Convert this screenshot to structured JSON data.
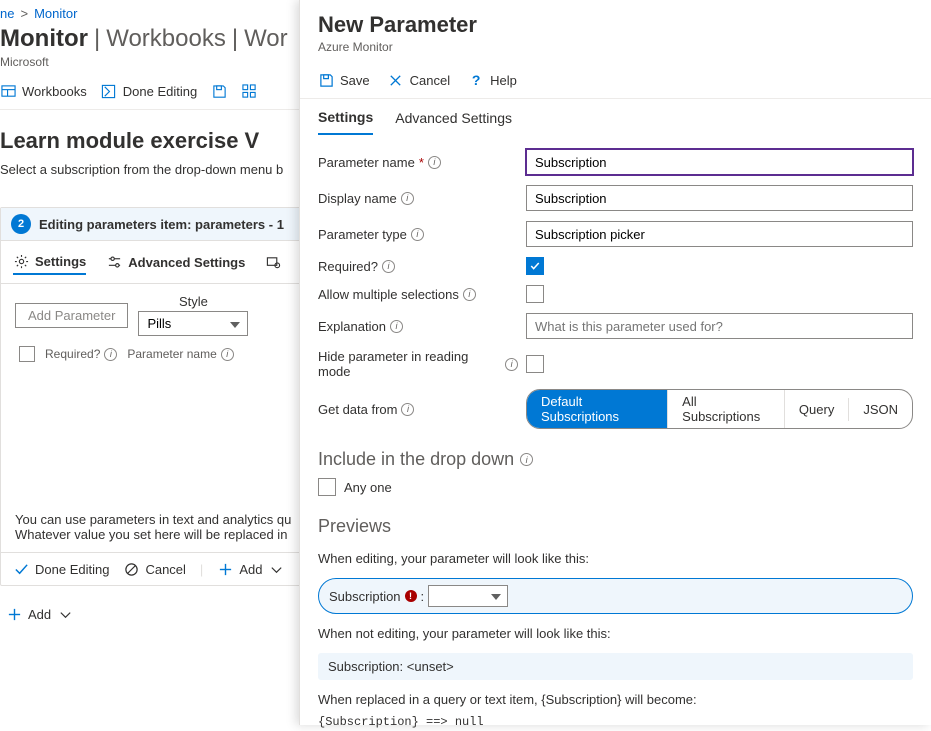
{
  "breadcrumb": {
    "home": "ne",
    "current": "Monitor",
    "sep": ">"
  },
  "page": {
    "title_main": "Monitor",
    "title_sep1": " | ",
    "title_part2": "Workbooks",
    "title_sep2": " | ",
    "title_part3": "Wor",
    "subtitle": "Microsoft"
  },
  "toolbar": {
    "workbooks": "Workbooks",
    "done_editing": "Done Editing"
  },
  "exercise": {
    "heading": "Learn module exercise V",
    "helper": "Select a subscription from the drop-down menu b"
  },
  "panel": {
    "step": "2",
    "title": "Editing parameters item: parameters - 1",
    "tab_settings": "Settings",
    "tab_advanced": "Advanced Settings",
    "style_label": "Style",
    "add_parameter": "Add Parameter",
    "style_value": "Pills",
    "col_required": "Required?",
    "col_param_name": "Parameter name",
    "note1": "You can use parameters in text and analytics qu",
    "note2": "Whatever value you set here will be replaced in",
    "done_editing": "Done Editing",
    "cancel": "Cancel",
    "add": "Add"
  },
  "footer_add": "Add",
  "blade": {
    "title": "New Parameter",
    "subtitle": "Azure Monitor",
    "save": "Save",
    "cancel": "Cancel",
    "help": "Help",
    "tab_settings": "Settings",
    "tab_advanced": "Advanced Settings",
    "fields": {
      "param_name_label": "Parameter name",
      "param_name_value": "Subscription",
      "display_name_label": "Display name",
      "display_name_value": "Subscription",
      "param_type_label": "Parameter type",
      "param_type_value": "Subscription picker",
      "required_label": "Required?",
      "required_checked": true,
      "allow_multi_label": "Allow multiple selections",
      "allow_multi_checked": false,
      "explanation_label": "Explanation",
      "explanation_placeholder": "What is this parameter used for?",
      "hide_label": "Hide parameter in reading mode",
      "hide_checked": false,
      "get_data_label": "Get data from",
      "get_data_options": [
        "Default Subscriptions",
        "All Subscriptions",
        "Query",
        "JSON"
      ],
      "get_data_selected": "Default Subscriptions"
    },
    "include_title": "Include in the drop down",
    "anyone": "Any one",
    "previews_title": "Previews",
    "preview_edit_text": "When editing, your parameter will look like this:",
    "preview_pill_label": "Subscription",
    "preview_pill_colon": ":",
    "preview_notedit_text": "When not editing, your parameter will look like this:",
    "preview_readonly": "Subscription: <unset>",
    "preview_replace_text": "When replaced in a query or text item, {Subscription} will become:",
    "preview_mono": "{Subscription} ==>  null"
  }
}
